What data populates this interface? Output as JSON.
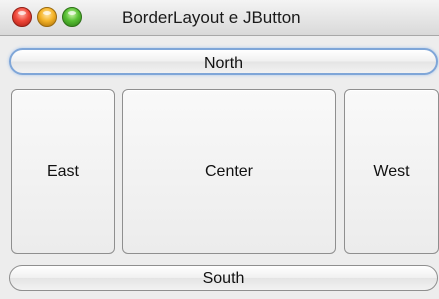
{
  "window": {
    "title": "BorderLayout e JButton",
    "controls": {
      "close_icon": "close-icon",
      "minimize_icon": "minimize-icon",
      "zoom_icon": "zoom-icon",
      "close_color": "#f0483a",
      "minimize_color": "#f5b428",
      "zoom_color": "#58c034"
    }
  },
  "layout": {
    "north": {
      "label": "North"
    },
    "east": {
      "label": "East"
    },
    "center": {
      "label": "Center"
    },
    "west": {
      "label": "West"
    },
    "south": {
      "label": "South"
    }
  },
  "colors": {
    "focus_ring": "#7fa6d8",
    "window_background": "#ededed"
  }
}
